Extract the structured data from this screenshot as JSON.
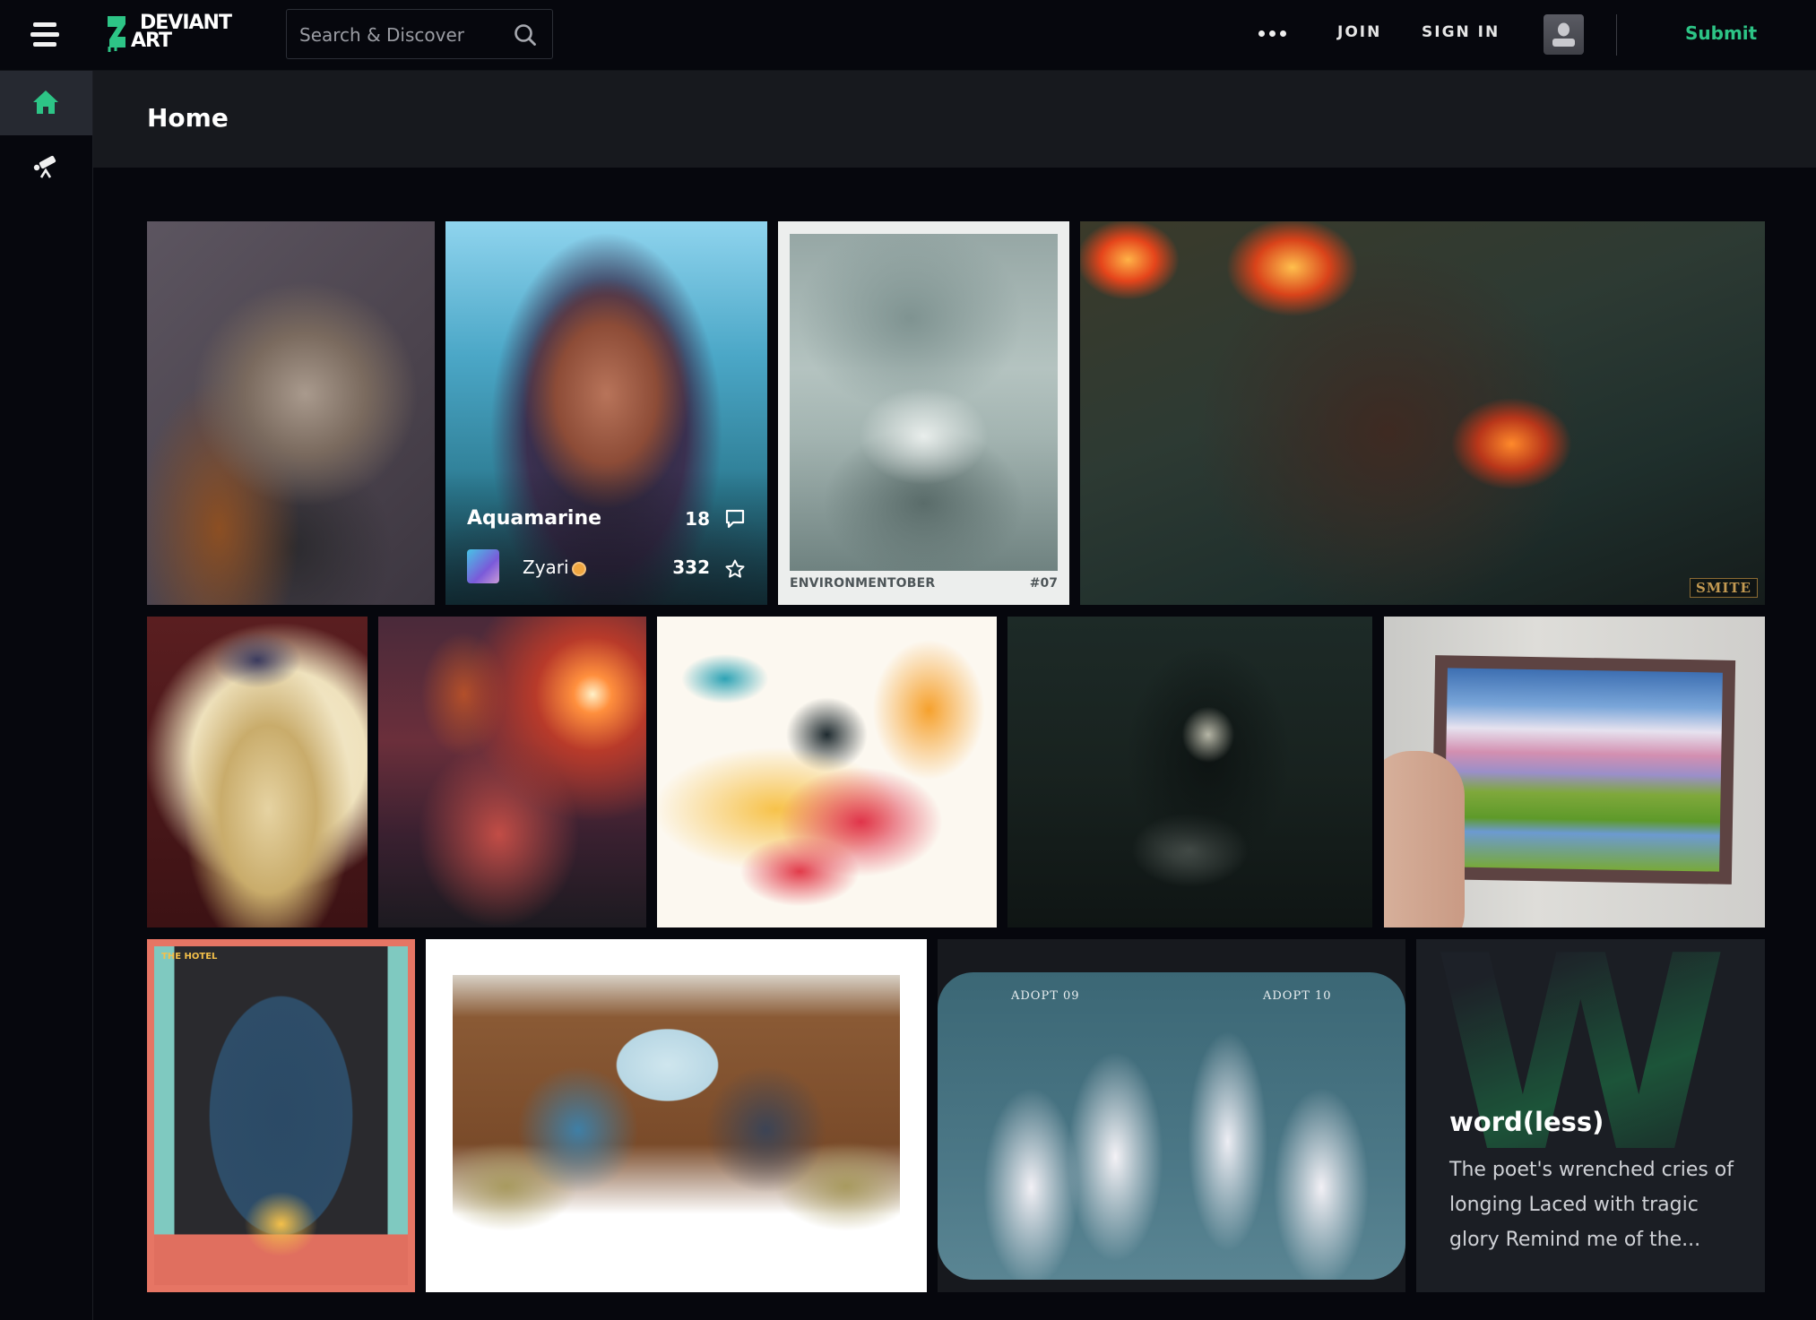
{
  "header": {
    "logo_line1": "DEVIANT",
    "logo_line2": "ART",
    "search": {
      "placeholder": "Search & Discover",
      "value": ""
    },
    "more_label": "More options",
    "join_label": "JOIN",
    "signin_label": "SIGN IN",
    "submit_label": "Submit",
    "brand_color": "#2dc486"
  },
  "sidebar": {
    "items": [
      {
        "id": "home",
        "icon": "home-icon",
        "label": "Home",
        "active": true
      },
      {
        "id": "discover",
        "icon": "telescope-icon",
        "label": "Discover",
        "active": false
      }
    ]
  },
  "page": {
    "title": "Home"
  },
  "gallery": {
    "rows": [
      [
        {
          "id": "calico-cat",
          "subject": "Pastel drawing of a calico kitten"
        },
        {
          "id": "aquamarine",
          "subject": "Portrait of woman with braids",
          "title": "Aquamarine",
          "author": "Zyari",
          "comments": "18",
          "favourites": "332",
          "hovered": true
        },
        {
          "id": "environmentober",
          "subject": "Monochrome landscape with castle on floating island",
          "caption": "ENVIRONMENTOBER",
          "number": "#07"
        },
        {
          "id": "smite-fire",
          "subject": "Hooded demon with flaming skull",
          "watermark": "SMITE"
        }
      ],
      [
        {
          "id": "moon-lady",
          "subject": "Woman in golden robes before moon"
        },
        {
          "id": "scarecrow-sunset",
          "subject": "Burning scarecrow at red sunset"
        },
        {
          "id": "witch-dragon",
          "subject": "Witch on broom with red dragon and rainbow"
        },
        {
          "id": "dark-creature",
          "subject": "Dark horror creature reaching over bed"
        },
        {
          "id": "embroidered-landscape",
          "subject": "Framed textured landscape painting held in hand"
        }
      ],
      [
        {
          "id": "the-hotel",
          "subject": "Hotel facade illustration",
          "label": "THE HOTEL"
        },
        {
          "id": "train-carriage",
          "subject": "Two characters in a train compartment"
        },
        {
          "id": "bunny-adopts",
          "subject": "Bunny-eared character adopts",
          "label_left": "ADOPT 09",
          "label_right": "ADOPT 10"
        },
        {
          "id": "wordless",
          "type": "literature",
          "title": "word(less)",
          "excerpt": "The poet's wrenched cries of longing Laced with tragic glory Remind me of the..."
        }
      ]
    ]
  }
}
